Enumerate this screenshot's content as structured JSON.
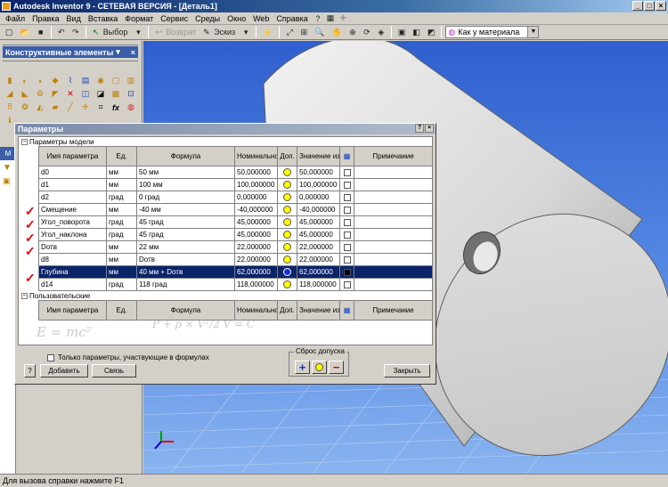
{
  "app": {
    "title": "Autodesk Inventor 9  - СЕТЕВАЯ ВЕРСИЯ - [Деталь1]"
  },
  "menu": [
    "Файл",
    "Правка",
    "Вид",
    "Вставка",
    "Формат",
    "Сервис",
    "Среды",
    "Окно",
    "Web",
    "Справка"
  ],
  "toolbar": {
    "select_label": "Выбор",
    "back_label": "Возврат",
    "sketch_label": "Эскиз",
    "material": "Как у материала"
  },
  "panel": {
    "title": "Конструктивные элементы"
  },
  "dialog": {
    "title": "Параметры",
    "group_model": "Параметры модели",
    "group_user": "Пользовательские",
    "columns": [
      "Имя параметра",
      "Ед.",
      "Формула",
      "Номинальное значение",
      "Доп.",
      "Значение из модели",
      "",
      "Примечание"
    ],
    "rows": [
      {
        "name": "d0",
        "unit": "мм",
        "formula": "50 мм",
        "nominal": "50,000000",
        "model": "50,000000"
      },
      {
        "name": "d1",
        "unit": "мм",
        "formula": "100 мм",
        "nominal": "100,000000",
        "model": "100,000000"
      },
      {
        "name": "d2",
        "unit": "град",
        "formula": "0 град",
        "nominal": "0,000000",
        "model": "0,000000"
      },
      {
        "name": "Смещение",
        "unit": "мм",
        "formula": "-40 мм",
        "nominal": "-40,000000",
        "model": "-40,000000"
      },
      {
        "name": "Угол_поворота",
        "unit": "град",
        "formula": "45 град",
        "nominal": "45,000000",
        "model": "45,000000"
      },
      {
        "name": "Угол_наклона",
        "unit": "град",
        "formula": "45 град",
        "nominal": "45,000000",
        "model": "45,000000"
      },
      {
        "name": "Dотв",
        "unit": "мм",
        "formula": "22 мм",
        "nominal": "22,000000",
        "model": "22,000000"
      },
      {
        "name": "d8",
        "unit": "мм",
        "formula": "Dотв",
        "nominal": "22,000000",
        "model": "22,000000"
      },
      {
        "name": "Глубина",
        "unit": "мм",
        "formula": "40 мм + Dотв",
        "nominal": "62,000000",
        "model": "62,000000"
      },
      {
        "name": "d14",
        "unit": "град",
        "formula": "118 град",
        "nominal": "118,000000",
        "model": "118,000000"
      }
    ],
    "selected_row": 8,
    "filter_checkbox": "Только параметры, участвующие в формулах",
    "add_button": "Добавить",
    "link_button": "Связь",
    "reset_label": "Сброс допуска",
    "close_button": "Закрыть",
    "help_button": "?"
  },
  "formulas": {
    "f1": "E = mc²",
    "f2": "P + ρ × V²/2 V = C"
  },
  "status": "Для вызова справки нажмите F1",
  "colors": {
    "viewport": "#4a7de0",
    "selection": "#0a246a",
    "tolerance_dot": "#ffff00"
  }
}
